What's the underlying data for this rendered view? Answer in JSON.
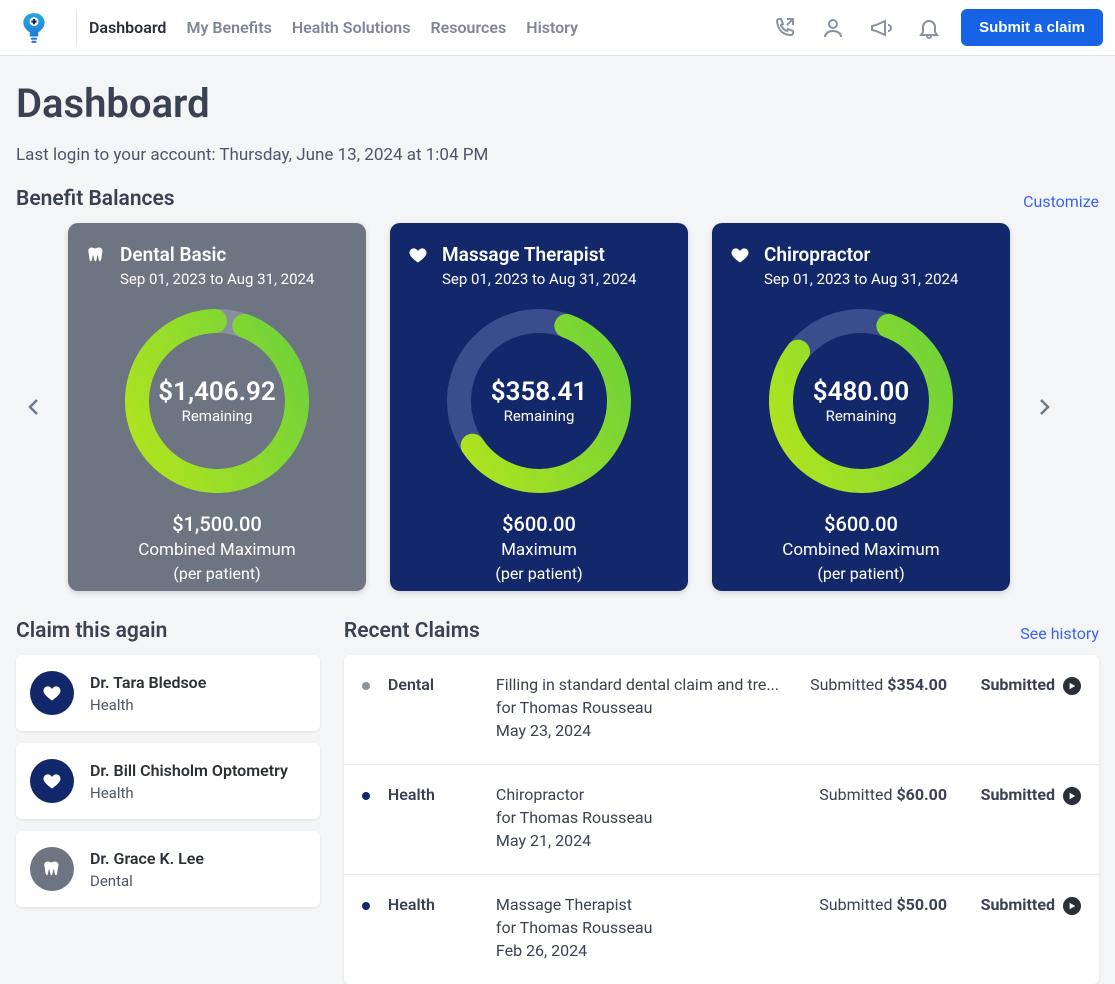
{
  "header": {
    "nav": [
      "Dashboard",
      "My Benefits",
      "Health Solutions",
      "Resources",
      "History"
    ],
    "active_nav": 0,
    "submit_label": "Submit a claim"
  },
  "page": {
    "title": "Dashboard",
    "last_login": "Last login to your account: Thursday, June 13, 2024 at 1:04 PM"
  },
  "balances": {
    "heading": "Benefit Balances",
    "customize_label": "Customize",
    "cards": [
      {
        "icon": "tooth",
        "theme": "grey",
        "title": "Dental Basic",
        "dates": "Sep 01, 2023 to Aug 31, 2024",
        "remaining": "$1,406.92",
        "remaining_label": "Remaining",
        "max": "$1,500.00",
        "max_label": "Combined Maximum",
        "note": "(per patient)",
        "pct": 0.94
      },
      {
        "icon": "heart",
        "theme": "navy",
        "title": "Massage Therapist",
        "dates": "Sep 01, 2023 to Aug 31, 2024",
        "remaining": "$358.41",
        "remaining_label": "Remaining",
        "max": "$600.00",
        "max_label": "Maximum",
        "note": "(per patient)",
        "pct": 0.6
      },
      {
        "icon": "heart",
        "theme": "navy",
        "title": "Chiropractor",
        "dates": "Sep 01, 2023 to Aug 31, 2024",
        "remaining": "$480.00",
        "remaining_label": "Remaining",
        "max": "$600.00",
        "max_label": "Combined Maximum",
        "note": "(per patient)",
        "pct": 0.8
      }
    ]
  },
  "claim_again": {
    "heading": "Claim this again",
    "items": [
      {
        "icon": "heart",
        "theme": "navy",
        "name": "Dr. Tara Bledsoe",
        "category": "Health"
      },
      {
        "icon": "heart",
        "theme": "navy",
        "name": "Dr. Bill Chisholm Optometry",
        "category": "Health"
      },
      {
        "icon": "tooth",
        "theme": "grey",
        "name": "Dr. Grace K. Lee",
        "category": "Dental"
      }
    ]
  },
  "recent": {
    "heading": "Recent Claims",
    "see_history_label": "See history",
    "submitted_word": "Submitted",
    "status_label": "Submitted",
    "rows": [
      {
        "dot": "grey",
        "category": "Dental",
        "desc": "Filling in standard dental claim and tre...",
        "for": "for Thomas Rousseau",
        "date": "May 23, 2024",
        "amount": "$354.00"
      },
      {
        "dot": "navy",
        "category": "Health",
        "desc": "Chiropractor",
        "for": "for Thomas Rousseau",
        "date": "May 21, 2024",
        "amount": "$60.00"
      },
      {
        "dot": "navy",
        "category": "Health",
        "desc": "Massage Therapist",
        "for": "for Thomas Rousseau",
        "date": "Feb 26, 2024",
        "amount": "$50.00"
      }
    ]
  },
  "colors": {
    "accent_green_a": "#b5e51d",
    "accent_green_b": "#6bd13a",
    "navy": "#12286b",
    "grey": "#6d7482",
    "track_on_navy": "#3a4d8c",
    "track_on_grey": "#888f9d"
  },
  "chart_data": [
    {
      "type": "pie",
      "title": "Dental Basic remaining",
      "categories": [
        "Remaining",
        "Used"
      ],
      "values": [
        1406.92,
        93.08
      ],
      "ylim": [
        0,
        1500
      ]
    },
    {
      "type": "pie",
      "title": "Massage Therapist remaining",
      "categories": [
        "Remaining",
        "Used"
      ],
      "values": [
        358.41,
        241.59
      ],
      "ylim": [
        0,
        600
      ]
    },
    {
      "type": "pie",
      "title": "Chiropractor remaining",
      "categories": [
        "Remaining",
        "Used"
      ],
      "values": [
        480.0,
        120.0
      ],
      "ylim": [
        0,
        600
      ]
    }
  ]
}
